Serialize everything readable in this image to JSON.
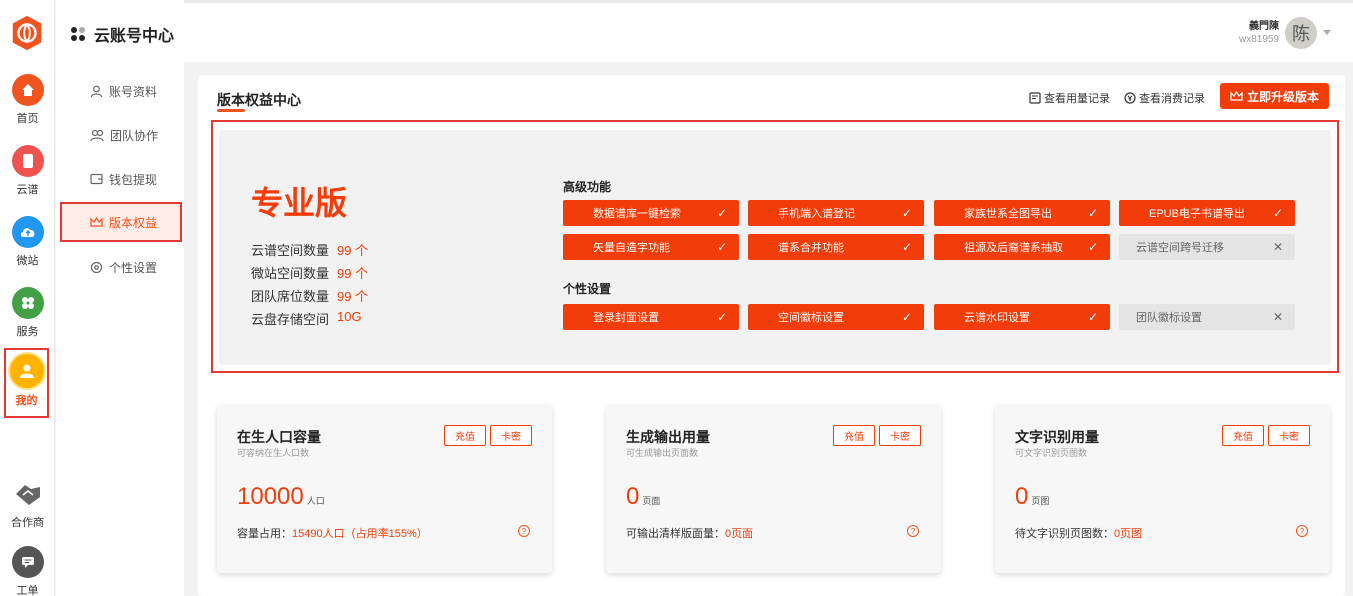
{
  "app": {
    "title": "云账号中心"
  },
  "rail": {
    "items": [
      {
        "label": "首页",
        "color": "#f0531e",
        "icon": "home-icon"
      },
      {
        "label": "云谱",
        "color": "#ef5350",
        "icon": "book-icon"
      },
      {
        "label": "微站",
        "color": "#2196f3",
        "icon": "cloud-upload-icon"
      },
      {
        "label": "服务",
        "color": "#43a047",
        "icon": "grid-icon"
      },
      {
        "label": "我的",
        "color": "#ffb300",
        "icon": "user-icon"
      },
      {
        "label": "合作商",
        "color": "#555555",
        "icon": "handshake-icon"
      },
      {
        "label": "工单",
        "color": "#555555",
        "icon": "ticket-icon"
      }
    ]
  },
  "sidebar": {
    "items": [
      {
        "label": "账号资料",
        "icon": "person-icon"
      },
      {
        "label": "团队协作",
        "icon": "team-icon"
      },
      {
        "label": "钱包提现",
        "icon": "wallet-icon"
      },
      {
        "label": "版本权益",
        "icon": "crown-icon"
      },
      {
        "label": "个性设置",
        "icon": "settings-icon"
      }
    ]
  },
  "user": {
    "name": "義門陳",
    "id": "wx81959",
    "avatar_char": "陈"
  },
  "panel": {
    "title": "版本权益中心",
    "link_usage": "查看用量记录",
    "link_spend": "查看消费记录",
    "upgrade": "立即升级版本"
  },
  "version": {
    "name": "专业版",
    "stats": [
      {
        "label": "云谱空间数量",
        "value": "99 个"
      },
      {
        "label": "微站空间数量",
        "value": "99 个"
      },
      {
        "label": "团队席位数量",
        "value": "99 个"
      },
      {
        "label": "云盘存储空间",
        "value": "10G"
      }
    ],
    "adv_title": "高级功能",
    "adv": [
      {
        "label": "数据谱库一键检索",
        "on": true
      },
      {
        "label": "手机端入谱登记",
        "on": true
      },
      {
        "label": "家族世系全图导出",
        "on": true
      },
      {
        "label": "EPUB电子书谱导出",
        "on": true
      },
      {
        "label": "矢量自造字功能",
        "on": true
      },
      {
        "label": "谱系合并功能",
        "on": true
      },
      {
        "label": "祖源及后裔谱系抽取",
        "on": true
      },
      {
        "label": "云谱空间跨号迁移",
        "on": false
      }
    ],
    "personal_title": "个性设置",
    "personal": [
      {
        "label": "登录封面设置",
        "on": true
      },
      {
        "label": "空间徽标设置",
        "on": true
      },
      {
        "label": "云谱水印设置",
        "on": true
      },
      {
        "label": "团队徽标设置",
        "on": false
      }
    ],
    "check": "✓",
    "cross": "✕"
  },
  "cards": [
    {
      "title": "在生人口容量",
      "sub": "可容纳在生人口数",
      "recharge": "充值",
      "card": "卡密",
      "num": "10000",
      "unit": "人口",
      "foot_label": "容量占用：",
      "foot_value": "15490人口（占用率155%）"
    },
    {
      "title": "生成输出用量",
      "sub": "可生成输出页面数",
      "recharge": "充值",
      "card": "卡密",
      "num": "0",
      "unit": "页面",
      "foot_label": "可输出清样版面量：",
      "foot_value": "0页面"
    },
    {
      "title": "文字识别用量",
      "sub": "可文字识别页图数",
      "recharge": "充值",
      "card": "卡密",
      "num": "0",
      "unit": "页图",
      "foot_label": "待文字识别页图数：",
      "foot_value": "0页图"
    }
  ]
}
